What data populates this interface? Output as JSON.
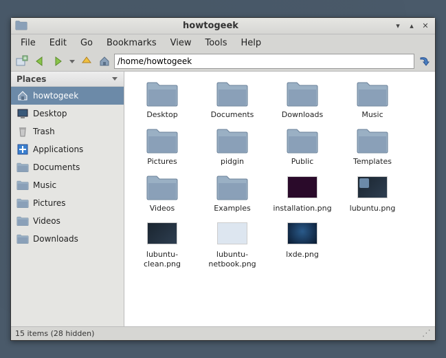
{
  "window": {
    "title": "howtogeek"
  },
  "menu": {
    "file": "File",
    "edit": "Edit",
    "go": "Go",
    "bookmarks": "Bookmarks",
    "view": "View",
    "tools": "Tools",
    "help": "Help"
  },
  "toolbar": {
    "path": "/home/howtogeek"
  },
  "sidebar": {
    "header": "Places",
    "items": [
      {
        "label": "howtogeek",
        "icon": "home",
        "selected": true
      },
      {
        "label": "Desktop",
        "icon": "desktop",
        "selected": false
      },
      {
        "label": "Trash",
        "icon": "trash",
        "selected": false
      },
      {
        "label": "Applications",
        "icon": "apps",
        "selected": false
      },
      {
        "label": "Documents",
        "icon": "folder",
        "selected": false
      },
      {
        "label": "Music",
        "icon": "folder",
        "selected": false
      },
      {
        "label": "Pictures",
        "icon": "folder",
        "selected": false
      },
      {
        "label": "Videos",
        "icon": "folder",
        "selected": false
      },
      {
        "label": "Downloads",
        "icon": "folder",
        "selected": false
      }
    ]
  },
  "files": [
    {
      "name": "Desktop",
      "type": "folder"
    },
    {
      "name": "Documents",
      "type": "folder"
    },
    {
      "name": "Downloads",
      "type": "folder"
    },
    {
      "name": "Music",
      "type": "folder"
    },
    {
      "name": "Pictures",
      "type": "folder"
    },
    {
      "name": "pidgin",
      "type": "folder"
    },
    {
      "name": "Public",
      "type": "folder"
    },
    {
      "name": "Templates",
      "type": "folder"
    },
    {
      "name": "Videos",
      "type": "folder"
    },
    {
      "name": "Examples",
      "type": "folder"
    },
    {
      "name": "installation.png",
      "type": "image",
      "variant": "purple"
    },
    {
      "name": "lubuntu.png",
      "type": "image",
      "variant": "lub"
    },
    {
      "name": "lubuntu-clean.png",
      "type": "image",
      "variant": "dark"
    },
    {
      "name": "lubuntu-netbook.png",
      "type": "image",
      "variant": "light"
    },
    {
      "name": "lxde.png",
      "type": "image",
      "variant": "lxde"
    }
  ],
  "status": {
    "text": "15 items (28 hidden)"
  }
}
